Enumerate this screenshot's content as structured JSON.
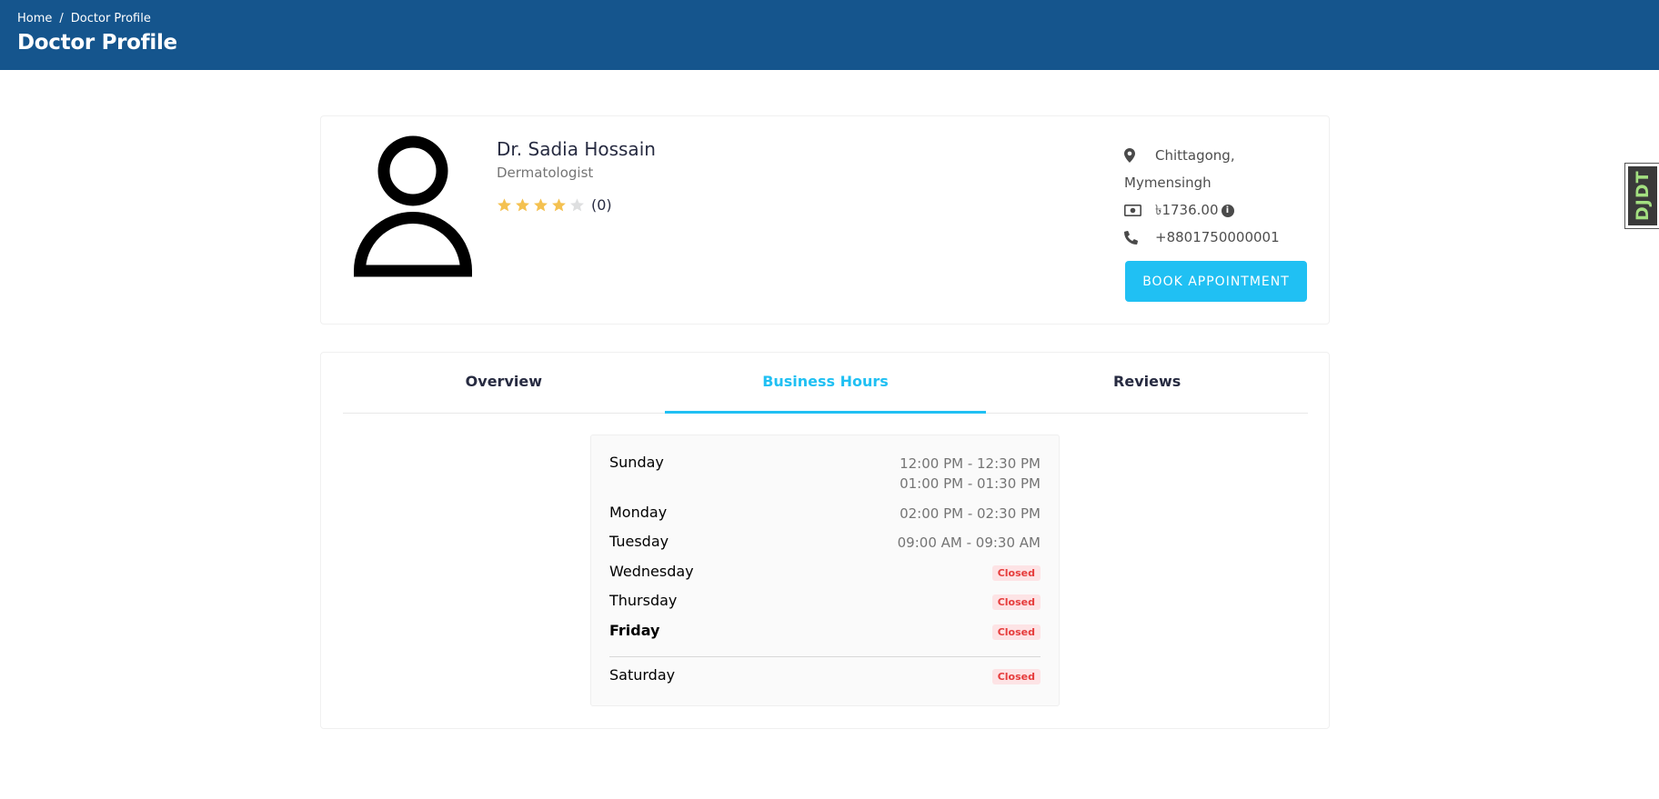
{
  "header": {
    "breadcrumb": {
      "home": "Home",
      "separator": "/",
      "current": "Doctor Profile"
    },
    "title": "Doctor Profile",
    "bg_color": "#15558d"
  },
  "doctor": {
    "name": "Dr. Sadia Hossain",
    "specialty": "Dermatologist",
    "rating": 4,
    "rating_max": 5,
    "rating_count": "(0)",
    "location_line1": "Chittagong,",
    "location_line2": "Mymensingh",
    "fee": "৳1736.00",
    "fee_info_icon": "info-icon",
    "phone": "+8801750000001",
    "book_label": "BOOK APPOINTMENT"
  },
  "tabs": [
    {
      "label": "Overview",
      "active": false
    },
    {
      "label": "Business Hours",
      "active": true
    },
    {
      "label": "Reviews",
      "active": false
    }
  ],
  "business_hours": [
    {
      "day": "Sunday",
      "times": [
        "12:00 PM - 12:30 PM",
        "01:00 PM - 01:30 PM"
      ]
    },
    {
      "day": "Monday",
      "times": [
        "02:00 PM - 02:30 PM"
      ]
    },
    {
      "day": "Tuesday",
      "times": [
        "09:00 AM - 09:30 AM"
      ]
    },
    {
      "day": "Wednesday",
      "status": "Closed"
    },
    {
      "day": "Thursday",
      "status": "Closed"
    },
    {
      "day": "Friday",
      "status": "Closed",
      "today": true
    },
    {
      "day": "Saturday",
      "status": "Closed"
    }
  ],
  "side_tag": {
    "text": "DJDT"
  },
  "colors": {
    "accent": "#20c0f3",
    "star": "#f4c150",
    "star_empty": "#dedfe0",
    "closed_bg": "#fde3e5",
    "closed_text": "#e63c3c"
  }
}
